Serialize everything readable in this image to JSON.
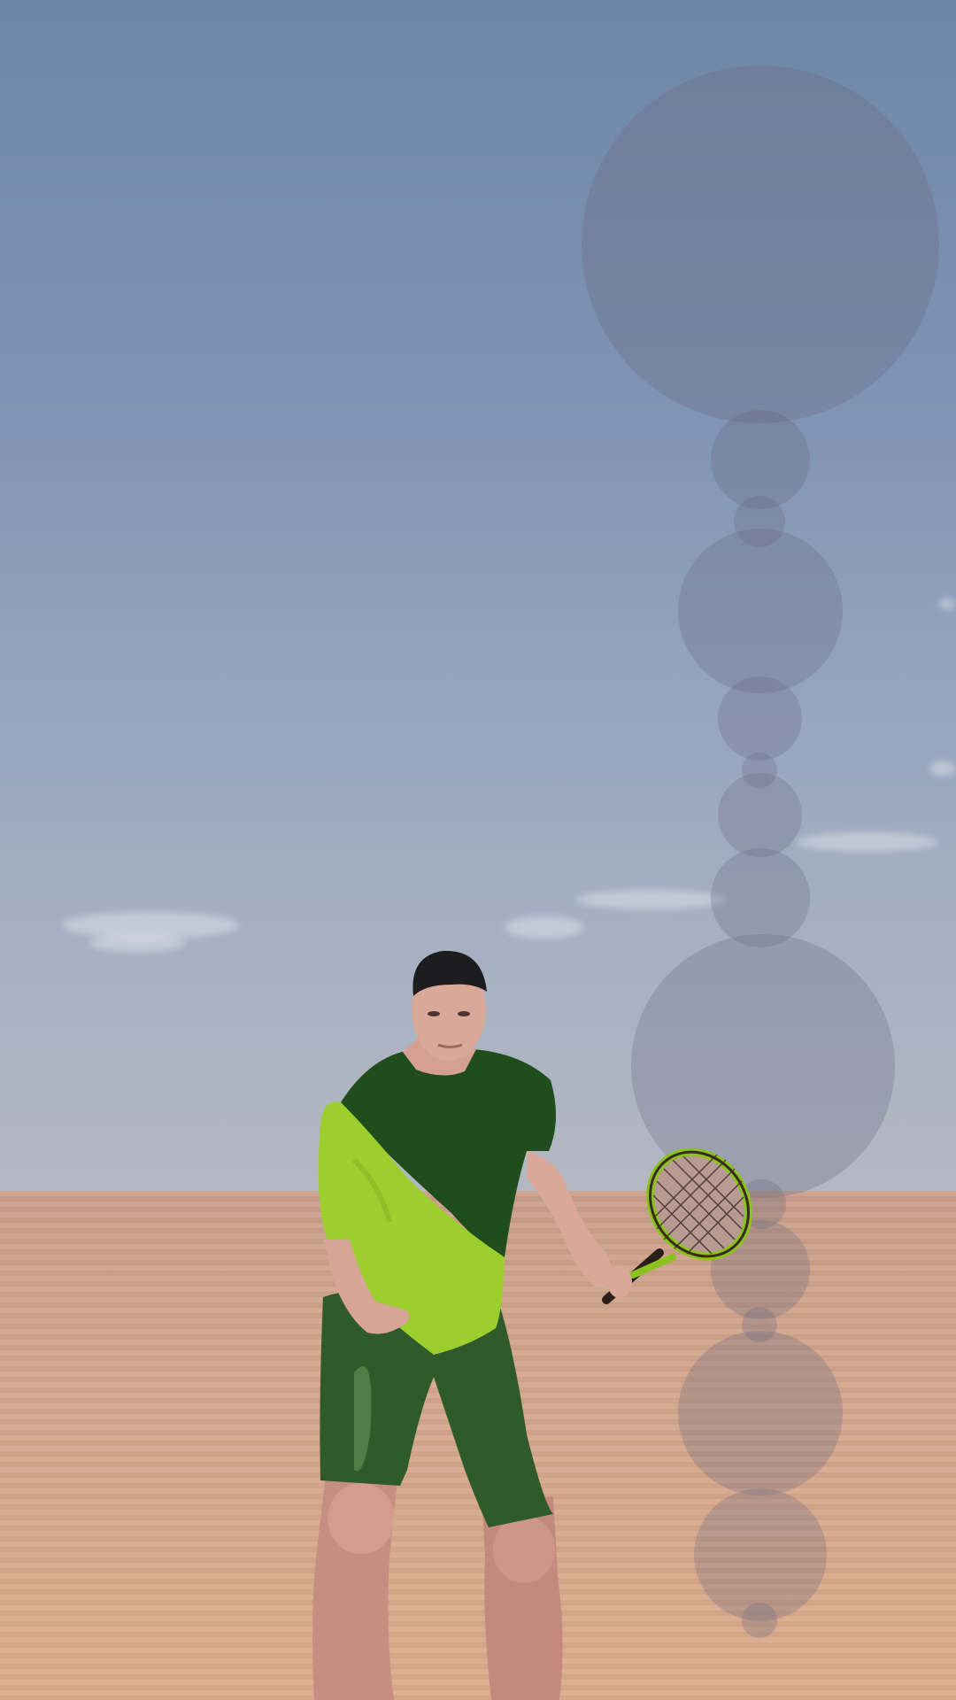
{
  "scene": {
    "sky_top_color": "#6f86a5",
    "sky_horizon_color": "#b3b8c1",
    "ground_color": "#d4a78c",
    "shirt_dark_color": "#1f4d1c",
    "shirt_light_color": "#9ccf2e",
    "shorts_color": "#2f5a2a",
    "racket_frame_color": "#8bc21e"
  },
  "icons": {
    "bubbles": "touch-trail-circles",
    "player": "tennis-player-avatar",
    "racket": "tennis-racket"
  }
}
